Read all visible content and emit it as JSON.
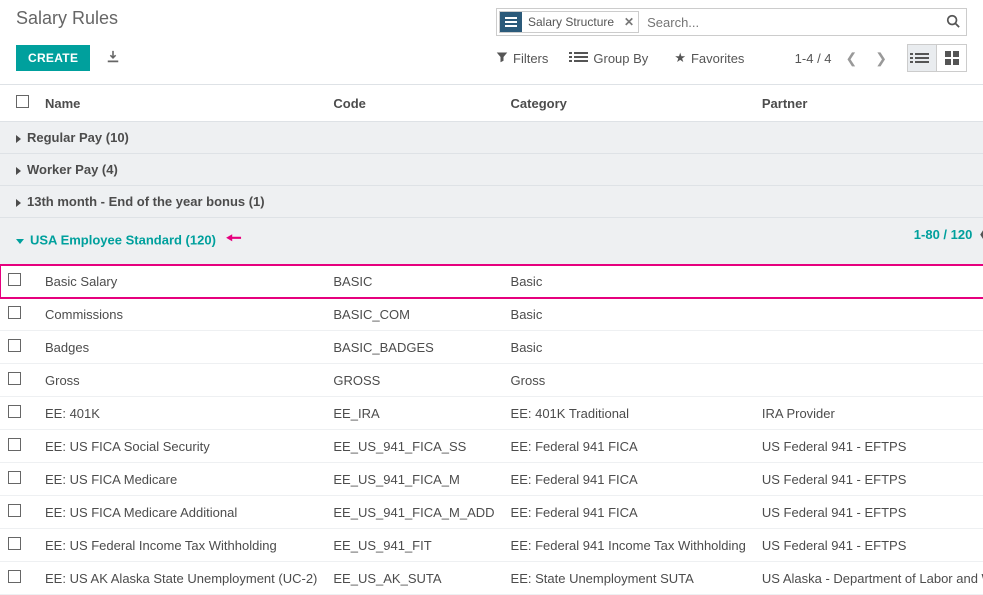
{
  "header": {
    "title": "Salary Rules",
    "search_facet_label": "Salary Structure",
    "search_placeholder": "Search..."
  },
  "toolbar": {
    "create_label": "CREATE",
    "filters_label": "Filters",
    "groupby_label": "Group By",
    "favorites_label": "Favorites",
    "pager_text": "1-4 / 4"
  },
  "columns": {
    "name": "Name",
    "code": "Code",
    "category": "Category",
    "partner": "Partner"
  },
  "groups": [
    {
      "label": "Regular Pay",
      "count": 10,
      "expanded": false
    },
    {
      "label": "Worker Pay",
      "count": 4,
      "expanded": false
    },
    {
      "label": "13th month - End of the year bonus",
      "count": 1,
      "expanded": false
    },
    {
      "label": "USA Employee Standard",
      "count": 120,
      "expanded": true,
      "pager": "1-80 / 120"
    }
  ],
  "rows": [
    {
      "name": "Basic Salary",
      "code": "BASIC",
      "category": "Basic",
      "partner": "",
      "highlight": true
    },
    {
      "name": "Commissions",
      "code": "BASIC_COM",
      "category": "Basic",
      "partner": ""
    },
    {
      "name": "Badges",
      "code": "BASIC_BADGES",
      "category": "Basic",
      "partner": ""
    },
    {
      "name": "Gross",
      "code": "GROSS",
      "category": "Gross",
      "partner": ""
    },
    {
      "name": "EE: 401K",
      "code": "EE_IRA",
      "category": "EE: 401K Traditional",
      "partner": "IRA Provider"
    },
    {
      "name": "EE: US FICA Social Security",
      "code": "EE_US_941_FICA_SS",
      "category": "EE: Federal 941 FICA",
      "partner": "US Federal 941 - EFTPS"
    },
    {
      "name": "EE: US FICA Medicare",
      "code": "EE_US_941_FICA_M",
      "category": "EE: Federal 941 FICA",
      "partner": "US Federal 941 - EFTPS"
    },
    {
      "name": "EE: US FICA Medicare Additional",
      "code": "EE_US_941_FICA_M_ADD",
      "category": "EE: Federal 941 FICA",
      "partner": "US Federal 941 - EFTPS"
    },
    {
      "name": "EE: US Federal Income Tax Withholding",
      "code": "EE_US_941_FIT",
      "category": "EE: Federal 941 Income Tax Withholding",
      "partner": "US Federal 941 - EFTPS"
    },
    {
      "name": "EE: US AK Alaska State Unemployment (UC-2)",
      "code": "EE_US_AK_SUTA",
      "category": "EE: State Unemployment SUTA",
      "partner": "US Alaska - Department of Labor and Wor…"
    }
  ]
}
